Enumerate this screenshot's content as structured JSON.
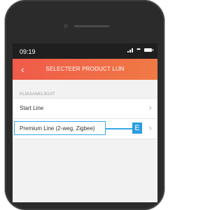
{
  "status_bar": {
    "time": "09:19"
  },
  "header": {
    "back_icon": "‹",
    "title": "SELECTEER PRODUCT LIJN"
  },
  "section": {
    "label": "KLIKAANKLIKUIT"
  },
  "items": [
    {
      "label": "Start Line",
      "chevron": "›"
    },
    {
      "label": "Premium Line (2-weg, Zigbee)",
      "chevron": "›"
    }
  ],
  "annotation": {
    "badge": "E"
  },
  "colors": {
    "accent": "#f05a4a",
    "highlight": "#3aa7e6"
  }
}
